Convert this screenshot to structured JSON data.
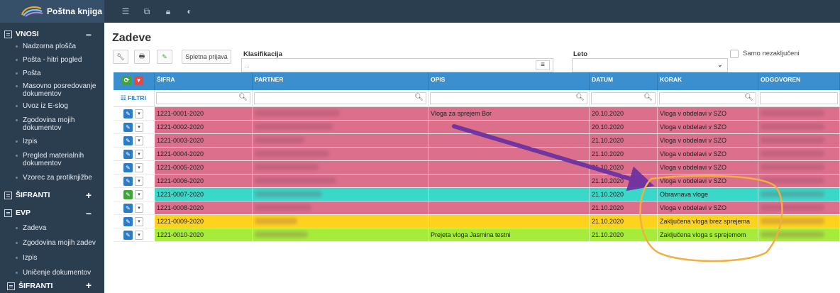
{
  "app": {
    "title": "Poštna knjiga"
  },
  "topbar_icons": [
    "list-icon",
    "external-link-icon",
    "lock-icon",
    "contrast-icon"
  ],
  "sidebar": {
    "sections": [
      {
        "label": "VNOSI",
        "sign": "−",
        "items": [
          "Nadzorna plošča",
          "Pošta - hitri pogled",
          "Pošta",
          "Masovno posredovanje dokumentov",
          "Uvoz iz E-slog",
          "Zgodovina mojih dokumentov",
          "Izpis",
          "Pregled materialnih dokumentov",
          "Vzorec za protiknjižbe"
        ]
      },
      {
        "label": "ŠIFRANTI",
        "sign": "+"
      },
      {
        "label": "EVP",
        "sign": "−",
        "items": [
          "Zadeva",
          "Zgodovina mojih zadev",
          "Izpis",
          "Uničenje dokumentov"
        ]
      },
      {
        "label": "ŠIFRANTI",
        "sign": "+"
      }
    ]
  },
  "main": {
    "title": "Zadeve",
    "toolbar": {
      "web_button": "Spletna prijava"
    },
    "klasifikacija_label": "Klasifikacija",
    "klasifikacija_placeholder": "...",
    "leto_label": "Leto",
    "samo_label": "Samo nezaključeni"
  },
  "table": {
    "filter_label": "FILTRI",
    "columns": [
      "ŠIFRA",
      "PARTNER",
      "OPIS",
      "DATUM",
      "KORAK",
      "ODGOVOREN"
    ],
    "rows": [
      {
        "sifra": "1221-0001-2020",
        "opis": "Vloga za sprejem Bor",
        "datum": "20.10.2020",
        "korak": "Vloga v obdelavi v SZO",
        "color": "#dc6f8c",
        "btn": "blue"
      },
      {
        "sifra": "1221-0002-2020",
        "opis": "",
        "datum": "20.10.2020",
        "korak": "Vloga v obdelavi v SZO",
        "color": "#dc6f8c",
        "btn": "blue"
      },
      {
        "sifra": "1221-0003-2020",
        "opis": "",
        "datum": "21.10.2020",
        "korak": "Vloga v obdelavi v SZO",
        "color": "#dc6f8c",
        "btn": "blue"
      },
      {
        "sifra": "1221-0004-2020",
        "opis": "",
        "datum": "21.10.2020",
        "korak": "Vloga v obdelavi v SZO",
        "color": "#dc6f8c",
        "btn": "blue"
      },
      {
        "sifra": "1221-0005-2020",
        "opis": "",
        "datum": "21.10.2020",
        "korak": "Vloga v obdelavi v SZO",
        "color": "#dc6f8c",
        "btn": "blue"
      },
      {
        "sifra": "1221-0006-2020",
        "opis": "",
        "datum": "21.10.2020",
        "korak": "Vloga v obdelavi v SZO",
        "color": "#dc6f8c",
        "btn": "blue"
      },
      {
        "sifra": "1221-0007-2020",
        "opis": "",
        "datum": "21.10.2020",
        "korak": "Obravnava vloge",
        "color": "#3ad8c9",
        "btn": "green"
      },
      {
        "sifra": "1221-0008-2020",
        "opis": "",
        "datum": "21.10.2020",
        "korak": "Vloga v obdelavi v SZO",
        "color": "#dc6f8c",
        "btn": "blue"
      },
      {
        "sifra": "1221-0009-2020",
        "opis": "",
        "datum": "21.10.2020",
        "korak": "Zaključena vloga brez sprejema",
        "color": "#ffd21e",
        "btn": "blue"
      },
      {
        "sifra": "1221-0010-2020",
        "opis": "Prejeta vloga Jasmina testni",
        "datum": "21.10.2020",
        "korak": "Zaključena vloga s sprejemom",
        "color": "#a8ec3b",
        "btn": "blue"
      }
    ]
  },
  "colors": {
    "sidebar": "#2b3e50",
    "header": "#3b8fcf",
    "arrow": "#6a2fa0",
    "highlight": "#f0b040"
  }
}
